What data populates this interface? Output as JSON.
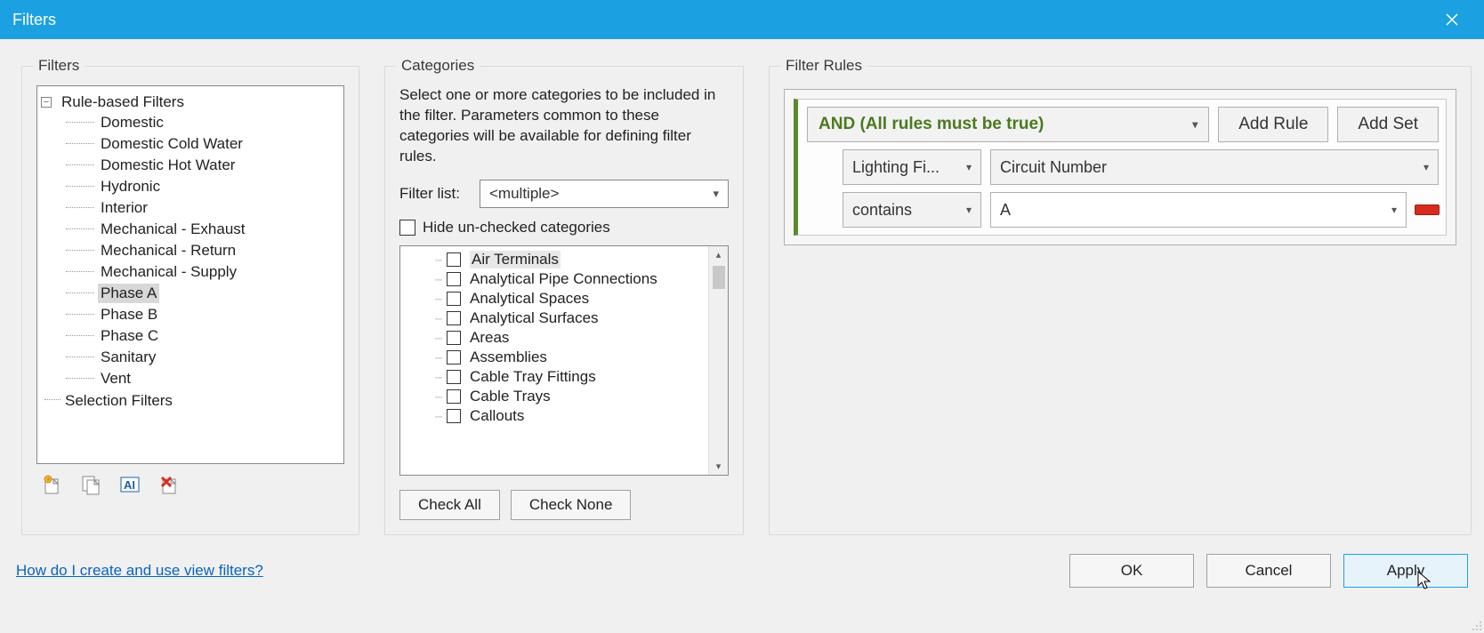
{
  "window": {
    "title": "Filters"
  },
  "filters_panel": {
    "legend": "Filters",
    "root_label": "Rule-based Filters",
    "items": [
      "Domestic",
      "Domestic Cold Water",
      "Domestic Hot Water",
      "Hydronic",
      "Interior",
      "Mechanical - Exhaust",
      "Mechanical - Return",
      "Mechanical - Supply",
      "Phase A",
      "Phase B",
      "Phase C",
      "Sanitary",
      "Vent"
    ],
    "selected_index": 8,
    "selection_filters_label": "Selection Filters",
    "icons": [
      "new-filter-icon",
      "duplicate-icon",
      "rename-icon",
      "delete-icon"
    ],
    "expander_symbol": "−"
  },
  "categories_panel": {
    "legend": "Categories",
    "description": "Select one or more categories to be included in the filter.  Parameters common to these categories will be available for defining filter rules.",
    "filter_list_label": "Filter list:",
    "filter_list_value": "<multiple>",
    "hide_label": "Hide un-checked categories",
    "items": [
      "Air Terminals",
      "Analytical Pipe Connections",
      "Analytical Spaces",
      "Analytical Surfaces",
      "Areas",
      "Assemblies",
      "Cable Tray Fittings",
      "Cable Trays",
      "Callouts"
    ],
    "highlight_index": 0,
    "check_all": "Check All",
    "check_none": "Check None"
  },
  "rules_panel": {
    "legend": "Filter Rules",
    "group_label": "AND (All rules must be true)",
    "add_rule": "Add Rule",
    "add_set": "Add Set",
    "rule1": {
      "category": "Lighting Fi...",
      "param": "Circuit Number",
      "op": "contains",
      "value": "A"
    }
  },
  "footer": {
    "help": "How do I create and use view filters?",
    "ok": "OK",
    "cancel": "Cancel",
    "apply": "Apply"
  }
}
